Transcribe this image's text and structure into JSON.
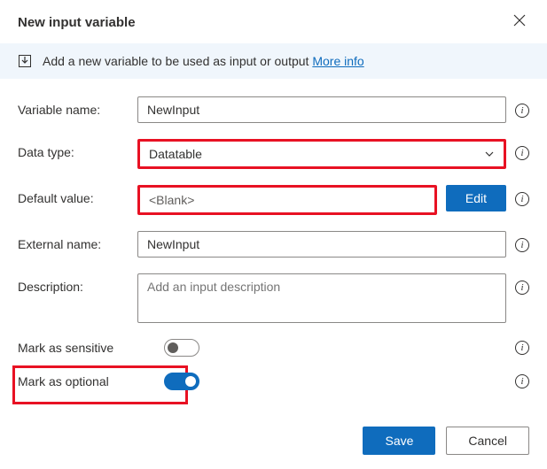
{
  "title": "New input variable",
  "banner": {
    "text": "Add a new variable to be used as input or output",
    "link_label": "More info"
  },
  "labels": {
    "variable_name": "Variable name:",
    "data_type": "Data type:",
    "default_value": "Default value:",
    "external_name": "External name:",
    "description": "Description:",
    "mark_sensitive": "Mark as sensitive",
    "mark_optional": "Mark as optional"
  },
  "values": {
    "variable_name": "NewInput",
    "data_type": "Datatable",
    "default_value": "<Blank>",
    "external_name": "NewInput",
    "description_placeholder": "Add an input description"
  },
  "buttons": {
    "edit": "Edit",
    "save": "Save",
    "cancel": "Cancel"
  },
  "toggles": {
    "sensitive": false,
    "optional": true
  },
  "colors": {
    "primary": "#0f6cbd",
    "highlight": "#e81123"
  }
}
